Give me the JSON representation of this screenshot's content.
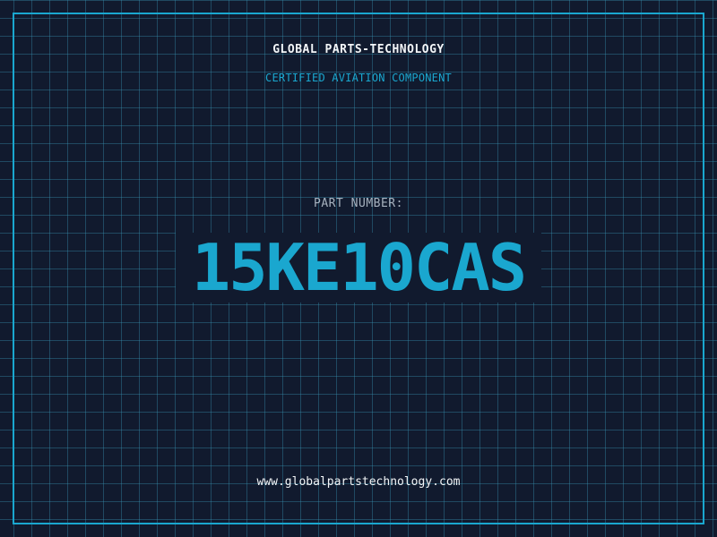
{
  "header": {
    "brand": "GLOBAL PARTS-TECHNOLOGY",
    "tagline": "CERTIFIED AVIATION COMPONENT"
  },
  "part": {
    "label": "PART NUMBER:",
    "number": "15KE10CAS"
  },
  "footer": {
    "website": "www.globalpartstechnology.com"
  },
  "colors": {
    "background": "#111a2e",
    "accent": "#1aa7cf",
    "text_primary": "#f2f5f7",
    "text_secondary": "#a7b2bf"
  }
}
